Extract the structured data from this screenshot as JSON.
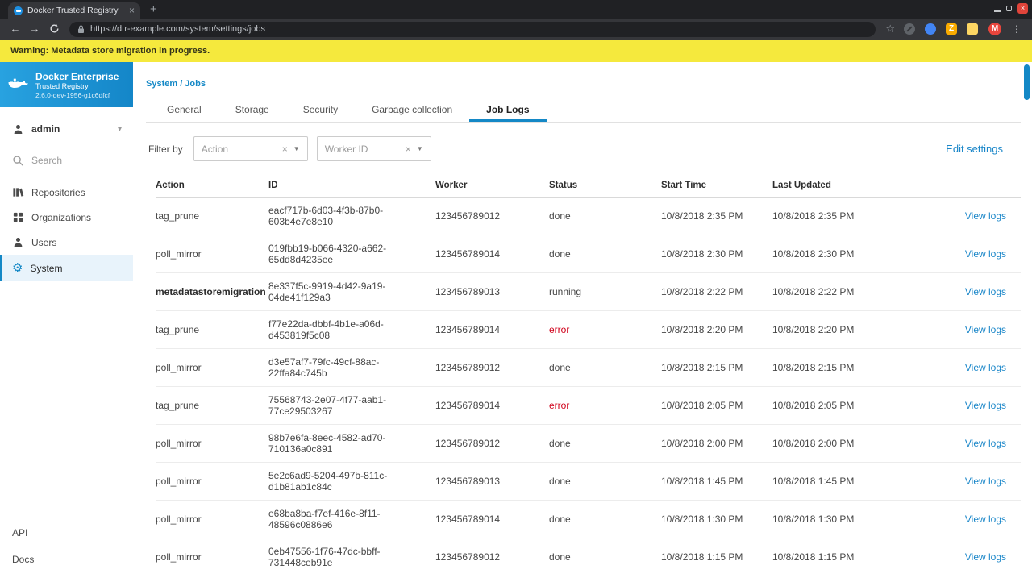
{
  "colors": {
    "accent": "#1488c6",
    "warning_bg": "#f5e93d",
    "error": "#d0021b",
    "link": "#1b87c9"
  },
  "browser": {
    "tab_title": "Docker Trusted Registry",
    "url": "https://dtr-example.com/system/settings/jobs",
    "avatar_initial": "M",
    "ext_z_label": "Z"
  },
  "warning": {
    "text": "Warning: Metadata store migration in progress."
  },
  "sidebar": {
    "brand": {
      "title": "Docker Enterprise",
      "subtitle": "Trusted Registry",
      "version": "2.6.0-dev-1956-g1c6dfcf"
    },
    "admin_label": "admin",
    "search_label": "Search",
    "items": [
      {
        "label": "Repositories"
      },
      {
        "label": "Organizations"
      },
      {
        "label": "Users"
      },
      {
        "label": "System"
      }
    ],
    "footer": {
      "api": "API",
      "docs": "Docs"
    }
  },
  "main": {
    "breadcrumb": "System / Jobs",
    "tabs": [
      {
        "label": "General"
      },
      {
        "label": "Storage"
      },
      {
        "label": "Security"
      },
      {
        "label": "Garbage collection"
      },
      {
        "label": "Job Logs"
      }
    ],
    "filter": {
      "label": "Filter by",
      "action_placeholder": "Action",
      "worker_placeholder": "Worker ID"
    },
    "edit_settings_label": "Edit settings",
    "table": {
      "headers": [
        "Action",
        "ID",
        "Worker",
        "Status",
        "Start Time",
        "Last Updated"
      ],
      "view_logs_label": "View logs",
      "rows": [
        {
          "action": "tag_prune",
          "id": "eacf717b-6d03-4f3b-87b0-603b4e7e8e10",
          "worker": "123456789012",
          "status": "done",
          "start_time": "10/8/2018 2:35 PM",
          "last_updated": "10/8/2018 2:35 PM"
        },
        {
          "action": "poll_mirror",
          "id": "019fbb19-b066-4320-a662-65dd8d4235ee",
          "worker": "123456789014",
          "status": "done",
          "start_time": "10/8/2018 2:30 PM",
          "last_updated": "10/8/2018 2:30 PM"
        },
        {
          "action": "metadatastoremigration",
          "id": "8e337f5c-9919-4d42-9a19-04de41f129a3",
          "worker": "123456789013",
          "status": "running",
          "start_time": "10/8/2018 2:22 PM",
          "last_updated": "10/8/2018 2:22 PM"
        },
        {
          "action": "tag_prune",
          "id": "f77e22da-dbbf-4b1e-a06d-d453819f5c08",
          "worker": "123456789014",
          "status": "error",
          "start_time": "10/8/2018 2:20 PM",
          "last_updated": "10/8/2018 2:20 PM"
        },
        {
          "action": "poll_mirror",
          "id": "d3e57af7-79fc-49cf-88ac-22ffa84c745b",
          "worker": "123456789012",
          "status": "done",
          "start_time": "10/8/2018 2:15 PM",
          "last_updated": "10/8/2018 2:15 PM"
        },
        {
          "action": "tag_prune",
          "id": "75568743-2e07-4f77-aab1-77ce29503267",
          "worker": "123456789014",
          "status": "error",
          "start_time": "10/8/2018 2:05 PM",
          "last_updated": "10/8/2018 2:05 PM"
        },
        {
          "action": "poll_mirror",
          "id": "98b7e6fa-8eec-4582-ad70-710136a0c891",
          "worker": "123456789012",
          "status": "done",
          "start_time": "10/8/2018 2:00 PM",
          "last_updated": "10/8/2018 2:00 PM"
        },
        {
          "action": "poll_mirror",
          "id": "5e2c6ad9-5204-497b-811c-d1b81ab1c84c",
          "worker": "123456789013",
          "status": "done",
          "start_time": "10/8/2018 1:45 PM",
          "last_updated": "10/8/2018 1:45 PM"
        },
        {
          "action": "poll_mirror",
          "id": "e68ba8ba-f7ef-416e-8f11-48596c0886e6",
          "worker": "123456789014",
          "status": "done",
          "start_time": "10/8/2018 1:30 PM",
          "last_updated": "10/8/2018 1:30 PM"
        },
        {
          "action": "poll_mirror",
          "id": "0eb47556-1f76-47dc-bbff-731448ceb91e",
          "worker": "123456789012",
          "status": "done",
          "start_time": "10/8/2018 1:15 PM",
          "last_updated": "10/8/2018 1:15 PM"
        }
      ]
    }
  }
}
